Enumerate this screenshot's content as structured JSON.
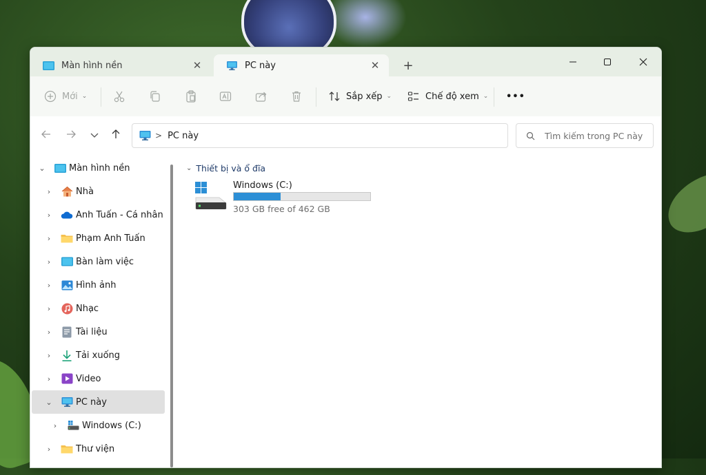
{
  "window": {
    "tabs": [
      {
        "title": "Màn hình nền",
        "active": false
      },
      {
        "title": "PC này",
        "active": true
      }
    ],
    "new_tab_symbol": "+"
  },
  "toolbar": {
    "new_label": "Mới",
    "sort_label": "Sắp xếp",
    "view_label": "Chế độ xem",
    "more_label": "•••",
    "icons": [
      "plus-circle-icon",
      "cut-icon",
      "copy-icon",
      "paste-icon",
      "rename-icon",
      "share-icon",
      "delete-icon",
      "sort-icon",
      "view-icon"
    ]
  },
  "address": {
    "breadcrumb": [
      "PC này"
    ],
    "separator": ">"
  },
  "search": {
    "placeholder": "Tìm kiếm trong PC này"
  },
  "sidebar": {
    "items": [
      {
        "label": "Màn hình nền",
        "icon": "desktop-icon",
        "expanded": true
      },
      {
        "label": "Nhà",
        "icon": "home-icon"
      },
      {
        "label": "Anh Tuấn - Cá nhân",
        "icon": "onedrive-icon"
      },
      {
        "label": "Phạm Anh Tuấn",
        "icon": "folder-icon"
      },
      {
        "label": "Bàn làm việc",
        "icon": "desktop-folder-icon"
      },
      {
        "label": "Hình ảnh",
        "icon": "pictures-icon"
      },
      {
        "label": "Nhạc",
        "icon": "music-icon"
      },
      {
        "label": "Tài liệu",
        "icon": "documents-icon"
      },
      {
        "label": "Tải xuống",
        "icon": "downloads-icon"
      },
      {
        "label": "Video",
        "icon": "videos-icon"
      },
      {
        "label": "PC này",
        "icon": "pc-icon",
        "expanded": true,
        "selected": true
      },
      {
        "label": "Windows (C:)",
        "icon": "drive-icon"
      },
      {
        "label": "Thư viện",
        "icon": "library-icon"
      }
    ]
  },
  "content": {
    "group_title": "Thiết bị và ổ đĩa",
    "drives": [
      {
        "name": "Windows (C:)",
        "free_text": "303 GB free of 462 GB",
        "free_gb": 303,
        "total_gb": 462,
        "used_fraction": 0.344
      }
    ]
  },
  "colors": {
    "accent": "#2c8fd6",
    "titlebar": "#e7eee5",
    "group_header": "#1e3a68"
  }
}
